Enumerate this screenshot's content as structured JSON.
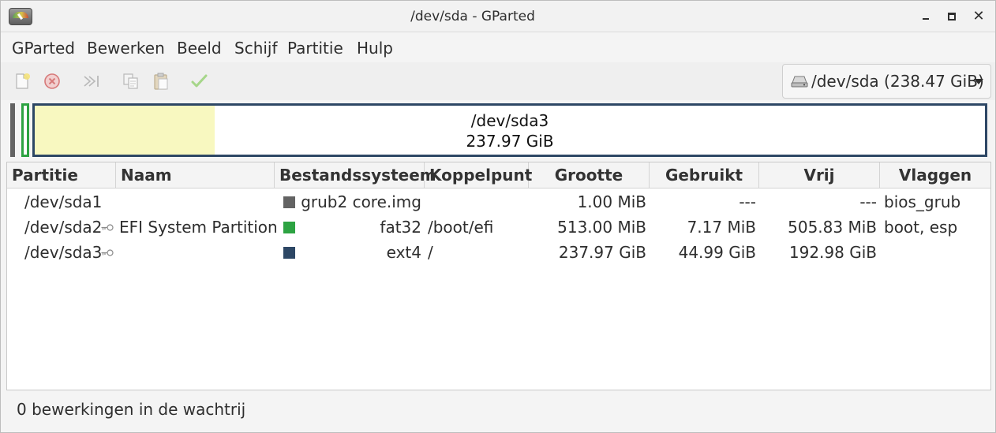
{
  "window": {
    "title": "/dev/sda - GParted"
  },
  "menu": [
    "GParted",
    "Bewerken",
    "Beeld",
    "Schijf",
    "Partitie",
    "Hulp"
  ],
  "toolbar": {
    "icons": [
      "new-icon",
      "delete-icon",
      "resize-move-icon",
      "copy-icon",
      "paste-icon",
      "apply-icon"
    ]
  },
  "device": {
    "label": "/dev/sda (238.47 GiB)"
  },
  "disk_map": {
    "main_partition": "/dev/sda3",
    "main_size": "237.97 GiB",
    "used_fraction": 0.189,
    "colors": {
      "unformatted": "#636363",
      "fat32": "#2da342",
      "ext4": "#2d4765",
      "used": "#f8f8c0"
    }
  },
  "table": {
    "columns": [
      "Partitie",
      "Naam",
      "Bestandssysteem",
      "Koppelpunt",
      "Grootte",
      "Gebruikt",
      "Vrij",
      "Vlaggen"
    ],
    "rows": [
      {
        "partition": "/dev/sda1",
        "name": "",
        "fs_color": "#636363",
        "filesystem": "grub2 core.img",
        "mount": "",
        "size": "1.00 MiB",
        "used": "---",
        "free": "---",
        "flags": "bios_grub",
        "mounted": false
      },
      {
        "partition": "/dev/sda2",
        "name": "EFI System Partition",
        "fs_color": "#2da342",
        "filesystem": "fat32",
        "mount": "/boot/efi",
        "size": "513.00 MiB",
        "used": "7.17 MiB",
        "free": "505.83 MiB",
        "flags": "boot, esp",
        "mounted": true
      },
      {
        "partition": "/dev/sda3",
        "name": "",
        "fs_color": "#2d4765",
        "filesystem": "ext4",
        "mount": "/",
        "size": "237.97 GiB",
        "used": "44.99 GiB",
        "free": "192.98 GiB",
        "flags": "",
        "mounted": true
      }
    ]
  },
  "status": {
    "text": "0 bewerkingen in de wachtrij"
  }
}
